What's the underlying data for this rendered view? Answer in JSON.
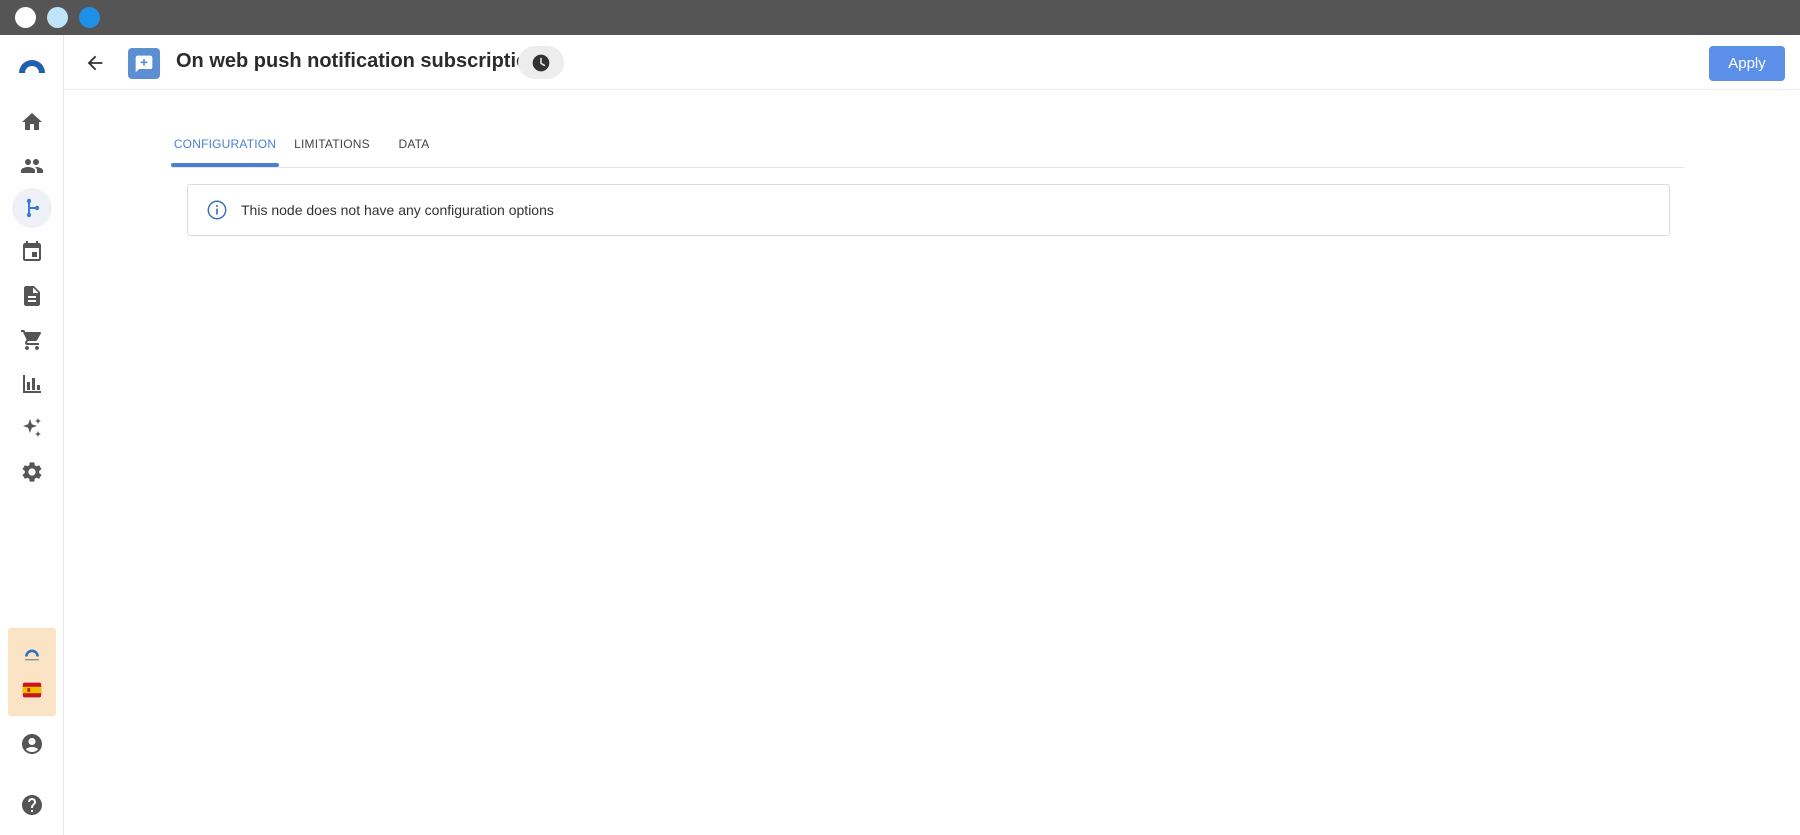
{
  "window": {
    "dots": [
      "#ffffff",
      "#bfe3f7",
      "#1e90e6"
    ]
  },
  "colors": {
    "accent": "#4a7fd4",
    "apply_button": "#5b8fe8",
    "node_badge": "#5b8fd1",
    "org_panel": "#fbe3c5"
  },
  "sidebar": {
    "logo_icon": "brand-arc-logo",
    "items": [
      {
        "icon": "home-icon",
        "active": false
      },
      {
        "icon": "people-icon",
        "active": false
      },
      {
        "icon": "workflow-branch-icon",
        "active": true
      },
      {
        "icon": "calendar-icon",
        "active": false
      },
      {
        "icon": "document-icon",
        "active": false
      },
      {
        "icon": "cart-icon",
        "active": false
      },
      {
        "icon": "bar-chart-icon",
        "active": false
      },
      {
        "icon": "sparkles-icon",
        "active": false
      },
      {
        "icon": "gear-icon",
        "active": false
      }
    ],
    "org_items": [
      {
        "icon": "org-logo-icon"
      },
      {
        "icon": "spain-flag-icon"
      }
    ],
    "account_icon": "account-circle-icon",
    "help_icon": "help-circle-icon"
  },
  "header": {
    "back_icon": "arrow-left-icon",
    "node_icon": "message-plus-icon",
    "title": "On web push notification subscription",
    "history_icon": "clock-icon",
    "apply_label": "Apply"
  },
  "tabs": [
    {
      "label": "CONFIGURATION",
      "active": true
    },
    {
      "label": "LIMITATIONS",
      "active": false
    },
    {
      "label": "DATA",
      "active": false
    }
  ],
  "info": {
    "icon": "info-circle-icon",
    "message": "This node does not have any configuration options"
  }
}
